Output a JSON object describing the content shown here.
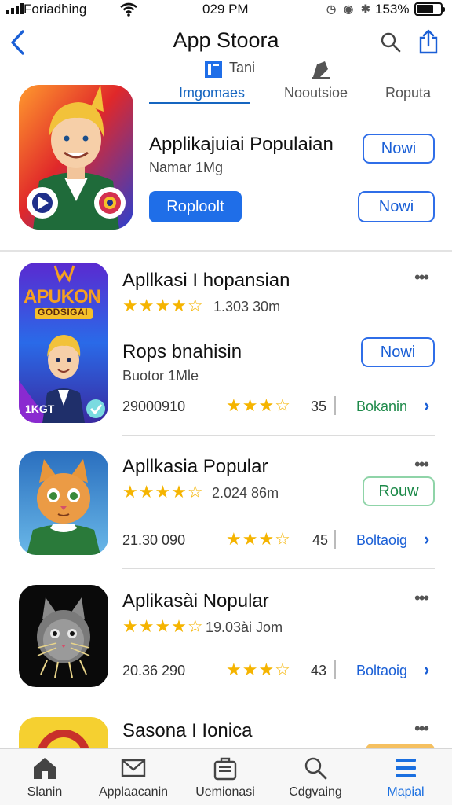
{
  "status_bar": {
    "carrier": "Foriadhing",
    "time": "029 PM",
    "battery": "153%"
  },
  "nav": {
    "title": "App Stoora"
  },
  "featured": {
    "tiny_label": "Tani",
    "tabs": [
      "Imgomaes",
      "Nooutsioe",
      "Roputa"
    ],
    "active_tab": 0,
    "title": "Applikajuiai Populaian",
    "subtitle": "Namar 1Mg",
    "primary_button": "Roploolt",
    "button_1": "Nowi",
    "button_2": "Nowi"
  },
  "apps": [
    {
      "name": "Apllkasi I hopansian",
      "rating_text": "1.303 30m",
      "icon_text_1": "APUKON",
      "icon_text_2": "GODSIGAI",
      "icon_text_3": "1KGT",
      "sub_name": "Rops bnahisin",
      "sub_meta": "Buotor 1Mle",
      "sub_button": "Nowi",
      "price": "29000910",
      "count": "35",
      "link": "Bokanin",
      "link_green": true
    },
    {
      "name": "Apllkasia Popular",
      "rating_text": "2.024 86m",
      "button": "Rouw",
      "price": "21.30 090",
      "count": "45",
      "link": "Boltaoig",
      "link_green": false
    },
    {
      "name": "Aplikasài Nopular",
      "rating_text": "19.03ài Jom",
      "price": "20.36 290",
      "count": "43",
      "link": "Boltaoig",
      "link_green": false
    },
    {
      "name": "Sasona I Ionica"
    }
  ],
  "tab_bar": {
    "items": [
      "Slanin",
      "Applaacanin",
      "Uemionasi",
      "Cdgvaing",
      "Mapial"
    ],
    "active": 4
  },
  "colors": {
    "accent": "#1f6ee8",
    "star": "#f5b400",
    "green_link": "#1e8a4a"
  },
  "icons": [
    "signal-icon",
    "wifi-icon",
    "back-chevron-icon",
    "search-icon",
    "share-icon",
    "more-dots-icon",
    "chevron-right-icon",
    "home-icon",
    "mail-icon",
    "briefcase-icon",
    "search-tab-icon",
    "menu-icon"
  ]
}
